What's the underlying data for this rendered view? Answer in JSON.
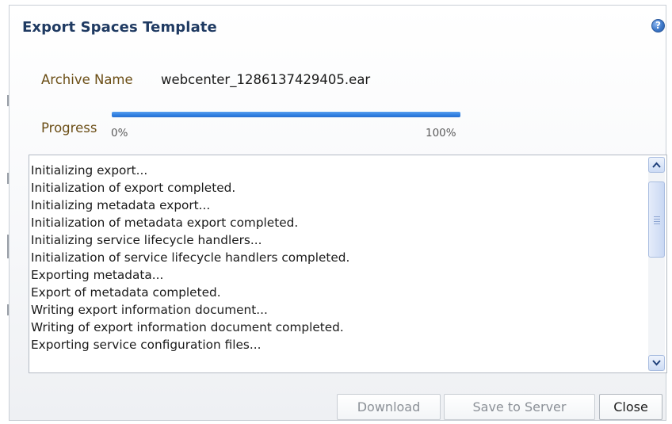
{
  "dialog": {
    "title": "Export Spaces Template",
    "help_icon": "question-mark-icon",
    "help_glyph": "?"
  },
  "archive": {
    "label": "Archive Name",
    "value": "webcenter_1286137429405.ear"
  },
  "progress": {
    "label": "Progress",
    "min_label": "0%",
    "max_label": "100%",
    "value_percent": 100
  },
  "log": {
    "lines": [
      "Initializing export...",
      "Initialization of export completed.",
      "Initializing metadata export...",
      "Initialization of metadata export completed.",
      "Initializing service lifecycle handlers...",
      "Initialization of service lifecycle handlers completed.",
      "Exporting metadata...",
      "Export of metadata completed.",
      "Writing export information document...",
      "Writing of export information document completed.",
      "Exporting service configuration files..."
    ]
  },
  "buttons": {
    "download": "Download",
    "save_to_server": "Save to Server",
    "close": "Close"
  },
  "colors": {
    "title": "#1f3a62",
    "field_label": "#6b4e16",
    "progress_fill": "#2f7fe0",
    "disabled_text": "#8a8f96"
  }
}
